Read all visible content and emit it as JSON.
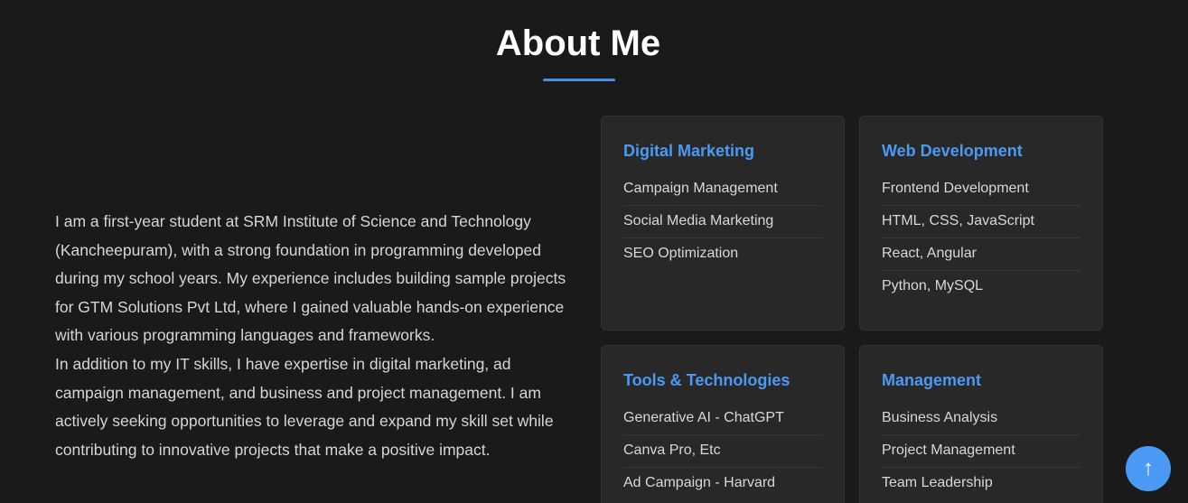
{
  "section": {
    "title": "About Me",
    "accent_color": "#4a90e2"
  },
  "bio": {
    "paragraph_1": "I am a first-year student at SRM Institute of Science and Technology (Kancheepuram), with a strong foundation in programming developed during my school years. My experience includes building sample projects for GTM Solutions Pvt Ltd, where I gained valuable hands-on experience with various programming languages and frameworks.",
    "paragraph_2": "In addition to my IT skills, I have expertise in digital marketing, ad campaign management, and business and project management. I am actively seeking opportunities to leverage and expand my skill set while contributing to innovative projects that make a positive impact."
  },
  "skills": [
    {
      "title": "Digital Marketing",
      "items": [
        "Campaign Management",
        "Social Media Marketing",
        "SEO Optimization"
      ]
    },
    {
      "title": "Web Development",
      "items": [
        "Frontend Development",
        "HTML, CSS, JavaScript",
        "React, Angular",
        "Python, MySQL"
      ]
    },
    {
      "title": "Tools & Technologies",
      "items": [
        "Generative AI - ChatGPT",
        "Canva Pro, Etc",
        "Ad Campaign - Harvard"
      ]
    },
    {
      "title": "Management",
      "items": [
        "Business Analysis",
        "Project Management",
        "Team Leadership"
      ]
    }
  ],
  "scroll_top": {
    "icon": "arrow-up-icon",
    "glyph": "↑",
    "color": "#4a9af5"
  }
}
